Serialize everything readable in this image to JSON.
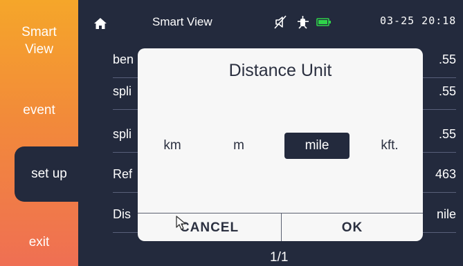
{
  "sidebar": {
    "items": [
      {
        "label_line1": "Smart",
        "label_line2": "View"
      },
      {
        "label": "event"
      },
      {
        "label": "set up"
      },
      {
        "label": "exit"
      }
    ]
  },
  "topbar": {
    "title": "Smart View",
    "clock": "03-25 20:18",
    "icons": [
      "home-icon",
      "mute-icon",
      "probe-icon",
      "battery-icon"
    ]
  },
  "list": {
    "rows": [
      {
        "label": "ben",
        "value": ".55"
      },
      {
        "label": "spli",
        "value": ".55"
      },
      {
        "label": "spli",
        "value": ".55"
      },
      {
        "label": "Ref",
        "value": "463"
      },
      {
        "label": "Dis",
        "value": "nile"
      }
    ],
    "page": "1/1"
  },
  "dialog": {
    "title": "Distance Unit",
    "options": [
      "km",
      "m",
      "mile",
      "kft."
    ],
    "selected": "mile",
    "cancel_label": "CANCEL",
    "ok_label": "OK"
  },
  "colors": {
    "background": "#232a3d",
    "sidebar_top": "#f5a62a",
    "sidebar_bottom": "#ef6f53",
    "dialog": "#f7f7f7",
    "battery": "#2fd24a"
  }
}
